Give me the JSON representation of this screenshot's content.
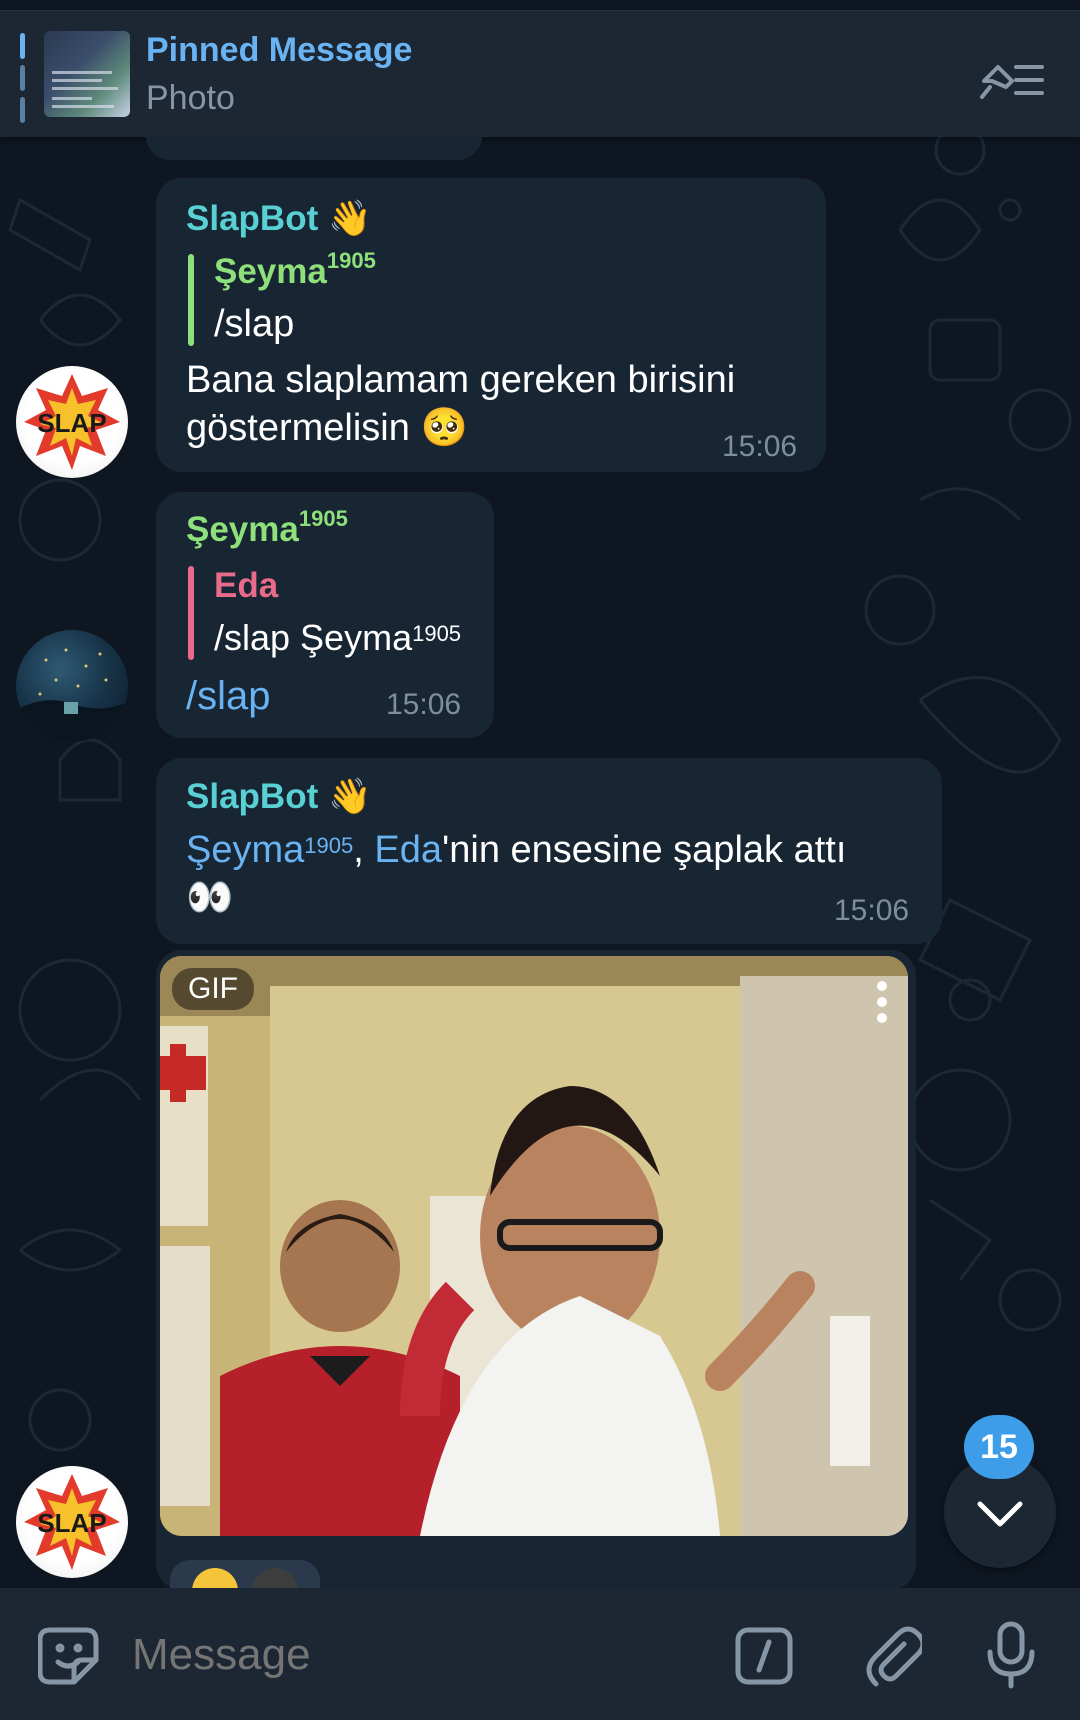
{
  "pinned": {
    "title": "Pinned Message",
    "subtitle": "Photo"
  },
  "messages": [
    {
      "sender": "SlapBot",
      "sender_emoji": "👋",
      "reply_to_name": "Şeyma",
      "reply_to_sup": "1905",
      "reply_to_text": "/slap",
      "text_line1": "Bana slaplamam gereken birisini",
      "text_line2": "göstermelisin",
      "text_emoji": "🥺",
      "time": "15:06"
    },
    {
      "sender": "Şeyma",
      "sender_sup": "1905",
      "reply_to_name": "Eda",
      "reply_to_text": "/slap Şeyma",
      "reply_to_sup": "1905",
      "text": "/slap",
      "time": "15:06"
    },
    {
      "sender": "SlapBot",
      "sender_emoji": "👋",
      "mention1": "Şeyma",
      "mention1_sup": "1905",
      "comma": ",",
      "mention2": "Eda",
      "text_rest": "'nin ensesine şaplak attı",
      "text_line2": "👀",
      "time": "15:06"
    }
  ],
  "gif": {
    "badge": "GIF"
  },
  "unread_count": "15",
  "input": {
    "placeholder": "Message"
  },
  "colors": {
    "accent": "#6ab3f3",
    "bot_name": "#58d0d4",
    "user_name": "#8ee07a",
    "eda_name": "#e86b8a",
    "bubble": "#182533",
    "background": "#0e1621"
  }
}
